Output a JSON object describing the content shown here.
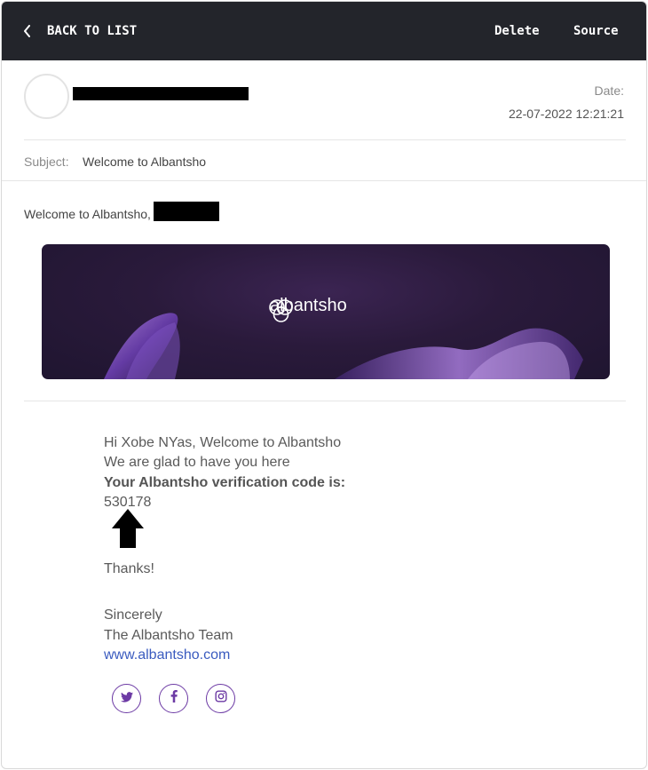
{
  "toolbar": {
    "back_label": "BACK TO LIST",
    "delete_label": "Delete",
    "source_label": "Source"
  },
  "email": {
    "date_label": "Date:",
    "date_value": "22-07-2022 12:21:21",
    "subject_label": "Subject:",
    "subject_value": "Welcome to Albantsho",
    "greeting": "Welcome to Albantsho,"
  },
  "banner": {
    "brand_name": "albantsho"
  },
  "message": {
    "line1": "Hi Xobe NYas, Welcome to Albantsho",
    "line2": "We are glad to have you here",
    "code_label": "Your Albantsho verification code is:",
    "code_value": "530178",
    "thanks": "Thanks!",
    "signoff": "Sincerely",
    "team": "The Albantsho Team",
    "website": "www.albantsho.com"
  },
  "social": {
    "icons": [
      "twitter-icon",
      "facebook-icon",
      "instagram-icon"
    ],
    "accent_color": "#6c3aa4"
  },
  "colors": {
    "header_bg": "#23252b",
    "link": "#3a5bbf"
  }
}
